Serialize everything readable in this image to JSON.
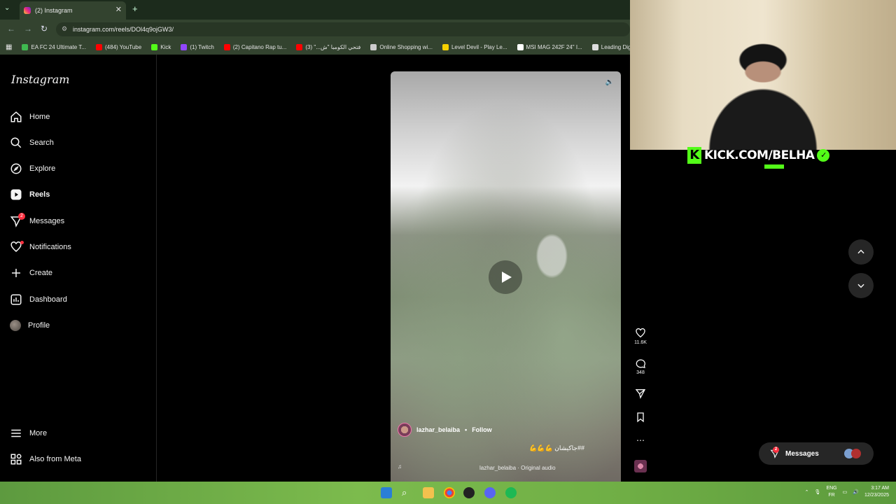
{
  "browser": {
    "tab_title": "(2) Instagram",
    "url": "instagram.com/reels/DOl4q9ojGW3/",
    "bookmarks": [
      {
        "label": "EA FC 24 Ultimate T...",
        "color": "#3fb950"
      },
      {
        "label": "(484) YouTube",
        "color": "#ff0000"
      },
      {
        "label": "Kick",
        "color": "#53fc18"
      },
      {
        "label": "(1) Twitch",
        "color": "#9146ff"
      },
      {
        "label": "(2) Capitano Rap tu...",
        "color": "#ff0000"
      },
      {
        "label": "فتحي الكومبا \"ش...\" (3)",
        "color": "#ff0000"
      },
      {
        "label": "Online Shopping wi...",
        "color": "#cccccc"
      },
      {
        "label": "Level Devil - Play Le...",
        "color": "#f5d000"
      },
      {
        "label": "MSI MAG 242F 24\" I...",
        "color": "#ffffff"
      },
      {
        "label": "Leading Digital",
        "color": "#dddddd"
      }
    ]
  },
  "sidebar": {
    "logo": "Instagram",
    "items": [
      {
        "label": "Home",
        "icon": "home-icon"
      },
      {
        "label": "Search",
        "icon": "search-icon"
      },
      {
        "label": "Explore",
        "icon": "compass-icon"
      },
      {
        "label": "Reels",
        "icon": "reels-icon"
      },
      {
        "label": "Messages",
        "icon": "messenger-icon",
        "badge": "2"
      },
      {
        "label": "Notifications",
        "icon": "heart-icon"
      },
      {
        "label": "Create",
        "icon": "plus-icon"
      },
      {
        "label": "Dashboard",
        "icon": "dashboard-icon"
      },
      {
        "label": "Profile",
        "icon": "avatar"
      }
    ],
    "bottom": [
      {
        "label": "More",
        "icon": "menu-icon"
      },
      {
        "label": "Also from Meta",
        "icon": "meta-icon"
      }
    ]
  },
  "reel": {
    "username": "lazhar_belaiba",
    "follow_label": "Follow",
    "separator": "•",
    "caption": "💪💪💪 جاكيشان##",
    "audio": "lazhar_belaiba · Original audio",
    "likes": "11.6K",
    "comments": "348"
  },
  "messages_pill": {
    "label": "Messages",
    "badge": "2"
  },
  "overlay": {
    "brand": "KICK.COM/BELHA",
    "k_letter": "K"
  },
  "taskbar": {
    "lang_top": "ENG",
    "lang_bottom": "FR",
    "time": "3:17 AM",
    "date": "12/23/2025"
  },
  "colors": {
    "instagram_badge": "#ff3040",
    "kick_green": "#53fc18",
    "browser_frame": "#33432f"
  }
}
